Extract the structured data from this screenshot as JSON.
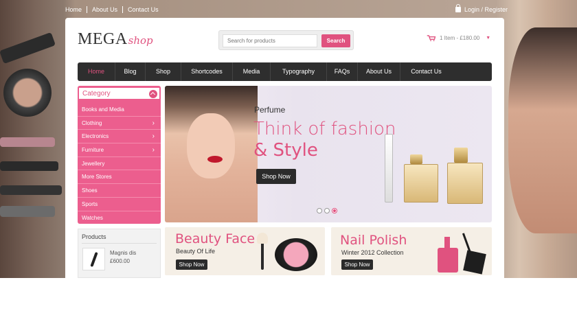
{
  "topbar": {
    "links": [
      "Home",
      "About Us",
      "Contact Us"
    ],
    "login_label": "Login / Register"
  },
  "logo": {
    "main": "MEGA",
    "accent": "shop"
  },
  "search": {
    "placeholder": "Search for products",
    "button": "Search"
  },
  "cart": {
    "summary": "1 Item - £180.00",
    "icon": "shopping-cart-icon"
  },
  "nav": {
    "items": [
      "Home",
      "Blog",
      "Shop",
      "Shortcodes",
      "Media",
      "Typography",
      "FAQs",
      "About Us",
      "Contact Us"
    ],
    "active": "Home"
  },
  "category": {
    "title": "Category",
    "items": [
      {
        "label": "Books and Media",
        "arrow": ""
      },
      {
        "label": "Clothing",
        "arrow": "›"
      },
      {
        "label": "Electronics",
        "arrow": "›"
      },
      {
        "label": "Furniture",
        "arrow": "›"
      },
      {
        "label": "Jewellery",
        "arrow": ""
      },
      {
        "label": "More Stores",
        "arrow": ""
      },
      {
        "label": "Shoes",
        "arrow": ""
      },
      {
        "label": "Sports",
        "arrow": ""
      },
      {
        "label": "Watches",
        "arrow": ""
      }
    ]
  },
  "slider": {
    "kicker": "Perfume",
    "headline_1": "Think of fashion",
    "headline_2": "& Style",
    "button": "Shop Now",
    "active_slide": 3,
    "slide_count": 3
  },
  "products": {
    "title": "Products",
    "item": {
      "name": "Magnis dis",
      "price": "£600.00"
    }
  },
  "promos": [
    {
      "title": "Beauty Face",
      "subtitle": "Beauty Of Life",
      "button": "Shop Now"
    },
    {
      "title": "Nail Polish",
      "subtitle": "Winter 2012 Collection",
      "button": "Shop Now"
    }
  ],
  "colors": {
    "accent": "#e0527f",
    "nav_bg": "#2e2e2e",
    "category_bg": "#ec5e8e"
  }
}
